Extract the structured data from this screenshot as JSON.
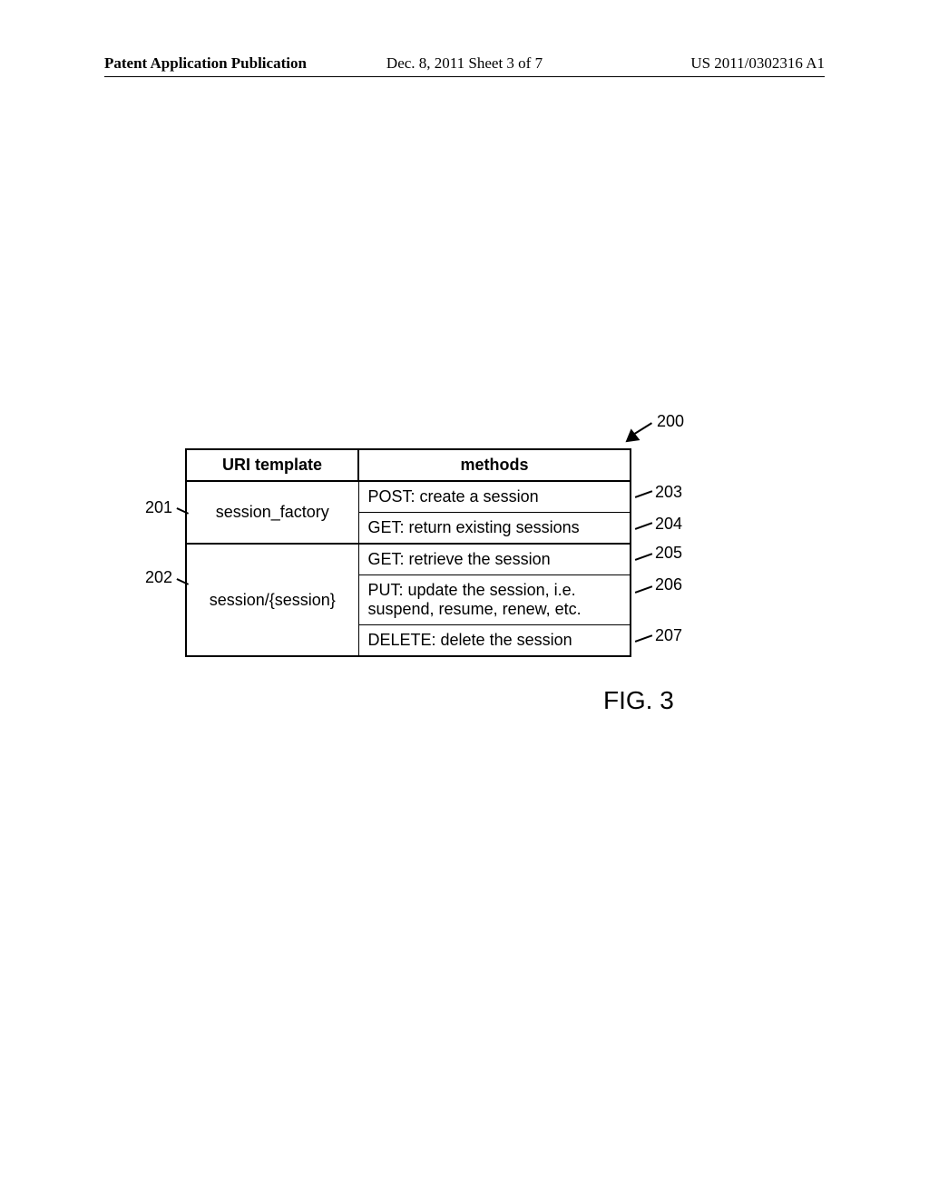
{
  "header": {
    "left": "Patent Application Publication",
    "middle": "Dec. 8, 2011  Sheet 3 of 7",
    "right": "US 2011/0302316 A1"
  },
  "table": {
    "headers": {
      "uri": "URI template",
      "methods": "methods"
    },
    "rows": {
      "r1": {
        "uri": "session_factory",
        "m1": "POST: create a session",
        "m2": "GET: return existing sessions"
      },
      "r2": {
        "uri": "session/{session}",
        "m1": "GET: retrieve the session",
        "m2": "PUT: update the session, i.e. suspend, resume, renew, etc.",
        "m3": "DELETE: delete the session"
      }
    }
  },
  "callouts": {
    "c200": "200",
    "c201": "201",
    "c202": "202",
    "c203": "203",
    "c204": "204",
    "c205": "205",
    "c206": "206",
    "c207": "207"
  },
  "figure": "FIG. 3"
}
